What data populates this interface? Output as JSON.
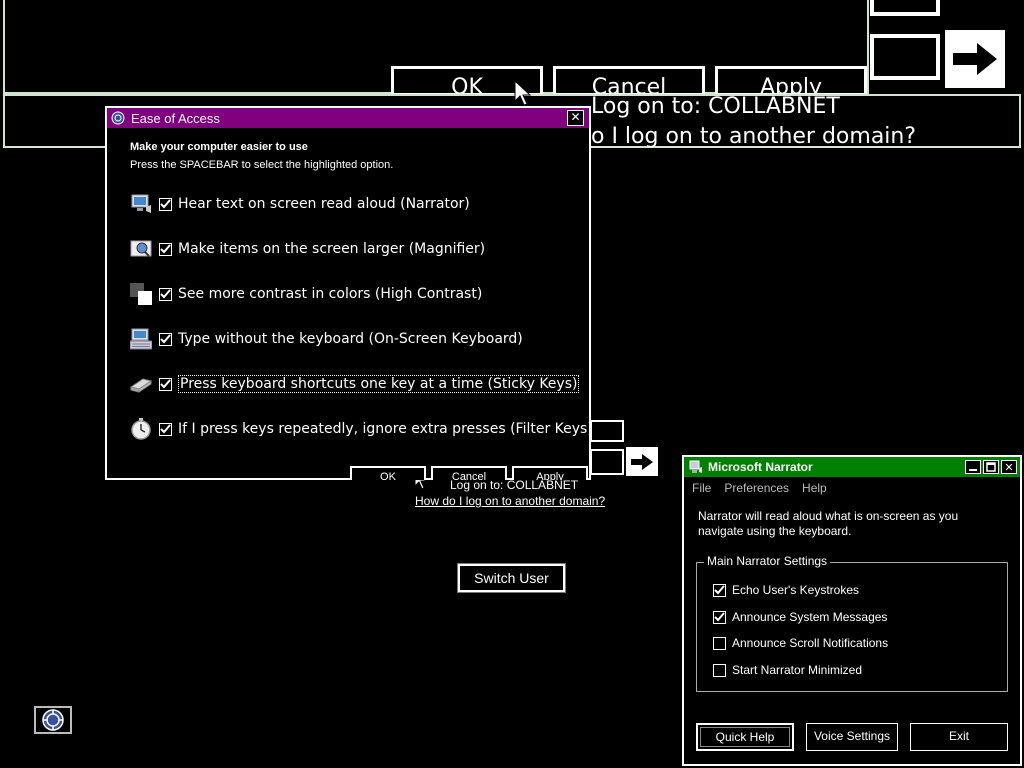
{
  "background": {
    "big_ok": "OK",
    "big_cancel": "Cancel",
    "big_apply": "Apply",
    "big_logon_to": "Log on to: COLLABNET",
    "big_other_domain": "o I log on to another domain?"
  },
  "logon": {
    "logon_to": "Log on to: COLLABNET",
    "other_domain_link": "How do I log on to another domain?",
    "switch_user": "Switch User"
  },
  "ease_of_access": {
    "title": "Ease of Access",
    "heading": "Make your computer easier to use",
    "subheading": "Press the SPACEBAR to select the highlighted option.",
    "options": [
      {
        "label": "Hear text on screen read aloud (Narrator)",
        "checked": true,
        "icon": "narrator-icon"
      },
      {
        "label": "Make items on the screen larger (Magnifier)",
        "checked": true,
        "icon": "magnifier-icon"
      },
      {
        "label": "See more contrast in colors (High Contrast)",
        "checked": true,
        "icon": "high-contrast-icon"
      },
      {
        "label": "Type without the keyboard (On-Screen Keyboard)",
        "checked": true,
        "icon": "keyboard-icon"
      },
      {
        "label": "Press keyboard shortcuts one key at a time (Sticky Keys)",
        "checked": true,
        "icon": "sticky-keys-icon"
      },
      {
        "label": "If I press keys repeatedly, ignore extra presses (Filter Keys)",
        "checked": true,
        "icon": "stopwatch-icon"
      }
    ],
    "ok": "OK",
    "cancel": "Cancel",
    "apply": "Apply"
  },
  "narrator": {
    "title": "Microsoft Narrator",
    "menu": [
      "File",
      "Preferences",
      "Help"
    ],
    "description": "Narrator will read aloud what is on-screen as you navigate using the keyboard.",
    "group_title": "Main Narrator Settings",
    "settings": [
      {
        "label": "Echo User's Keystrokes",
        "checked": true
      },
      {
        "label": "Announce System Messages",
        "checked": true
      },
      {
        "label": "Announce Scroll Notifications",
        "checked": false
      },
      {
        "label": "Start Narrator Minimized",
        "checked": false
      }
    ],
    "quick_help": "Quick Help",
    "voice_settings": "Voice Settings",
    "exit": "Exit"
  },
  "colors": {
    "eoa_titlebar": "#800080",
    "narrator_titlebar": "#008000",
    "magnifier_border": "#cfe5cf"
  }
}
